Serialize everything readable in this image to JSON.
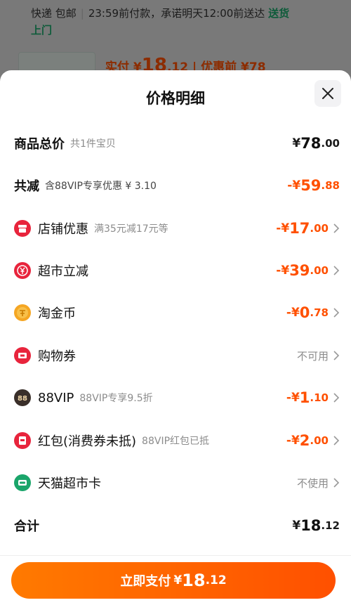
{
  "background": {
    "delivery": "快递 包邮",
    "deadline": "23:59前付款，承诺明天12:00前送达",
    "delivery_tag_1": "送货",
    "delivery_tag_2": "上门",
    "pay_prefix": "实付",
    "pay_cur": "¥",
    "pay_int": "18",
    "pay_dec": ".12",
    "pay_sep": "|",
    "pay_before": "优惠前 ¥78"
  },
  "sheet": {
    "title": "价格明细"
  },
  "rows": {
    "total_goods": {
      "label": "商品总价",
      "sub": "共1件宝贝",
      "cur": "¥",
      "int": "78",
      "dec": ".00"
    },
    "total_reduce": {
      "label": "共减",
      "sub": "含88VIP专享优惠 ¥ 3.10",
      "cur": "-¥",
      "int": "59",
      "dec": ".88"
    },
    "shop_coupon": {
      "label": "店铺优惠",
      "sub": "满35元减17元等",
      "cur": "-¥",
      "int": "17",
      "dec": ".00"
    },
    "market_cut": {
      "label": "超市立减",
      "sub": "",
      "cur": "-¥",
      "int": "39",
      "dec": ".00"
    },
    "taojinbi": {
      "label": "淘金币",
      "sub": "",
      "cur": "-¥",
      "int": "0",
      "dec": ".78"
    },
    "shopping_voucher": {
      "label": "购物券",
      "sub": "",
      "status": "不可用"
    },
    "vip88": {
      "label": "88VIP",
      "sub": "88VIP专享9.5折",
      "cur": "-¥",
      "int": "1",
      "dec": ".10"
    },
    "red_packet": {
      "label": "红包(消费券未抵)",
      "sub": "88VIP红包已抵",
      "cur": "-¥",
      "int": "2",
      "dec": ".00"
    },
    "tmall_card": {
      "label": "天猫超市卡",
      "sub": "",
      "status": "不使用"
    },
    "sum": {
      "label": "合计",
      "cur": "¥",
      "int": "18",
      "dec": ".12"
    }
  },
  "pay_button": {
    "label": "立即支付",
    "cur": "¥",
    "int": "18",
    "dec": ".12"
  },
  "colors": {
    "accent": "#ff5000",
    "red_icon": "#e8243c",
    "gold_icon": "#f5a623",
    "vip_icon": "#3a2f2a",
    "green_icon": "#1aa56a"
  },
  "icons": {
    "shop_coupon": "shop-coupon-icon",
    "market_cut": "yen-coin-icon",
    "taojinbi": "taojinbi-coin-icon",
    "shopping_voucher": "voucher-icon",
    "vip88": "vip88-icon",
    "red_packet": "red-packet-icon",
    "tmall_card": "tmall-market-card-icon",
    "close": "close-icon",
    "chevron": "chevron-right-icon"
  }
}
